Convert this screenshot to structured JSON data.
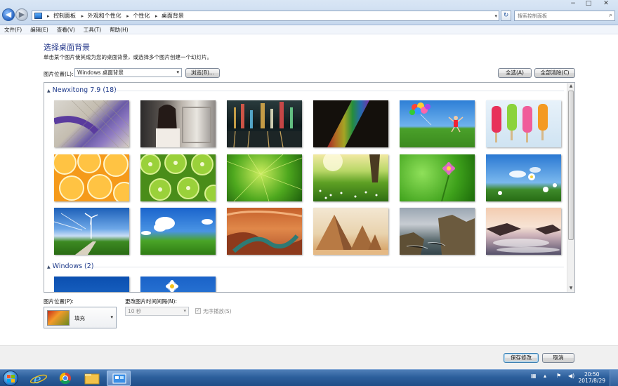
{
  "window": {
    "breadcrumbs": [
      "控制面板",
      "外观和个性化",
      "个性化",
      "桌面背景"
    ],
    "search_placeholder": "搜索控制面板",
    "controls": {
      "minimize": "−",
      "maximize": "□",
      "close": "✕"
    }
  },
  "menu": [
    "文件(F)",
    "编辑(E)",
    "查看(V)",
    "工具(T)",
    "帮助(H)"
  ],
  "page": {
    "title": "选择桌面背景",
    "subtitle": "单击某个图片使其成为您的桌面背景，或选择多个图片创建一个幻灯片。",
    "location_label": "图片位置(L):",
    "location_value": "Windows 桌面背景",
    "browse_button": "浏览(B)...",
    "select_all_button": "全选(A)",
    "clear_all_button": "全部清除(C)"
  },
  "groups": [
    {
      "title": "Newxitong 7.9 (18)"
    },
    {
      "title": "Windows (2)"
    }
  ],
  "options": {
    "position_label": "图片位置(P):",
    "position_value": "填充",
    "interval_label": "更改图片时间间隔(N):",
    "interval_value": "10 秒",
    "shuffle_label": "无序播放(S)"
  },
  "footer": {
    "save_button": "保存修改",
    "cancel_button": "取消"
  },
  "taskbar": {
    "time": "20:50",
    "date": "2017/8/29"
  }
}
